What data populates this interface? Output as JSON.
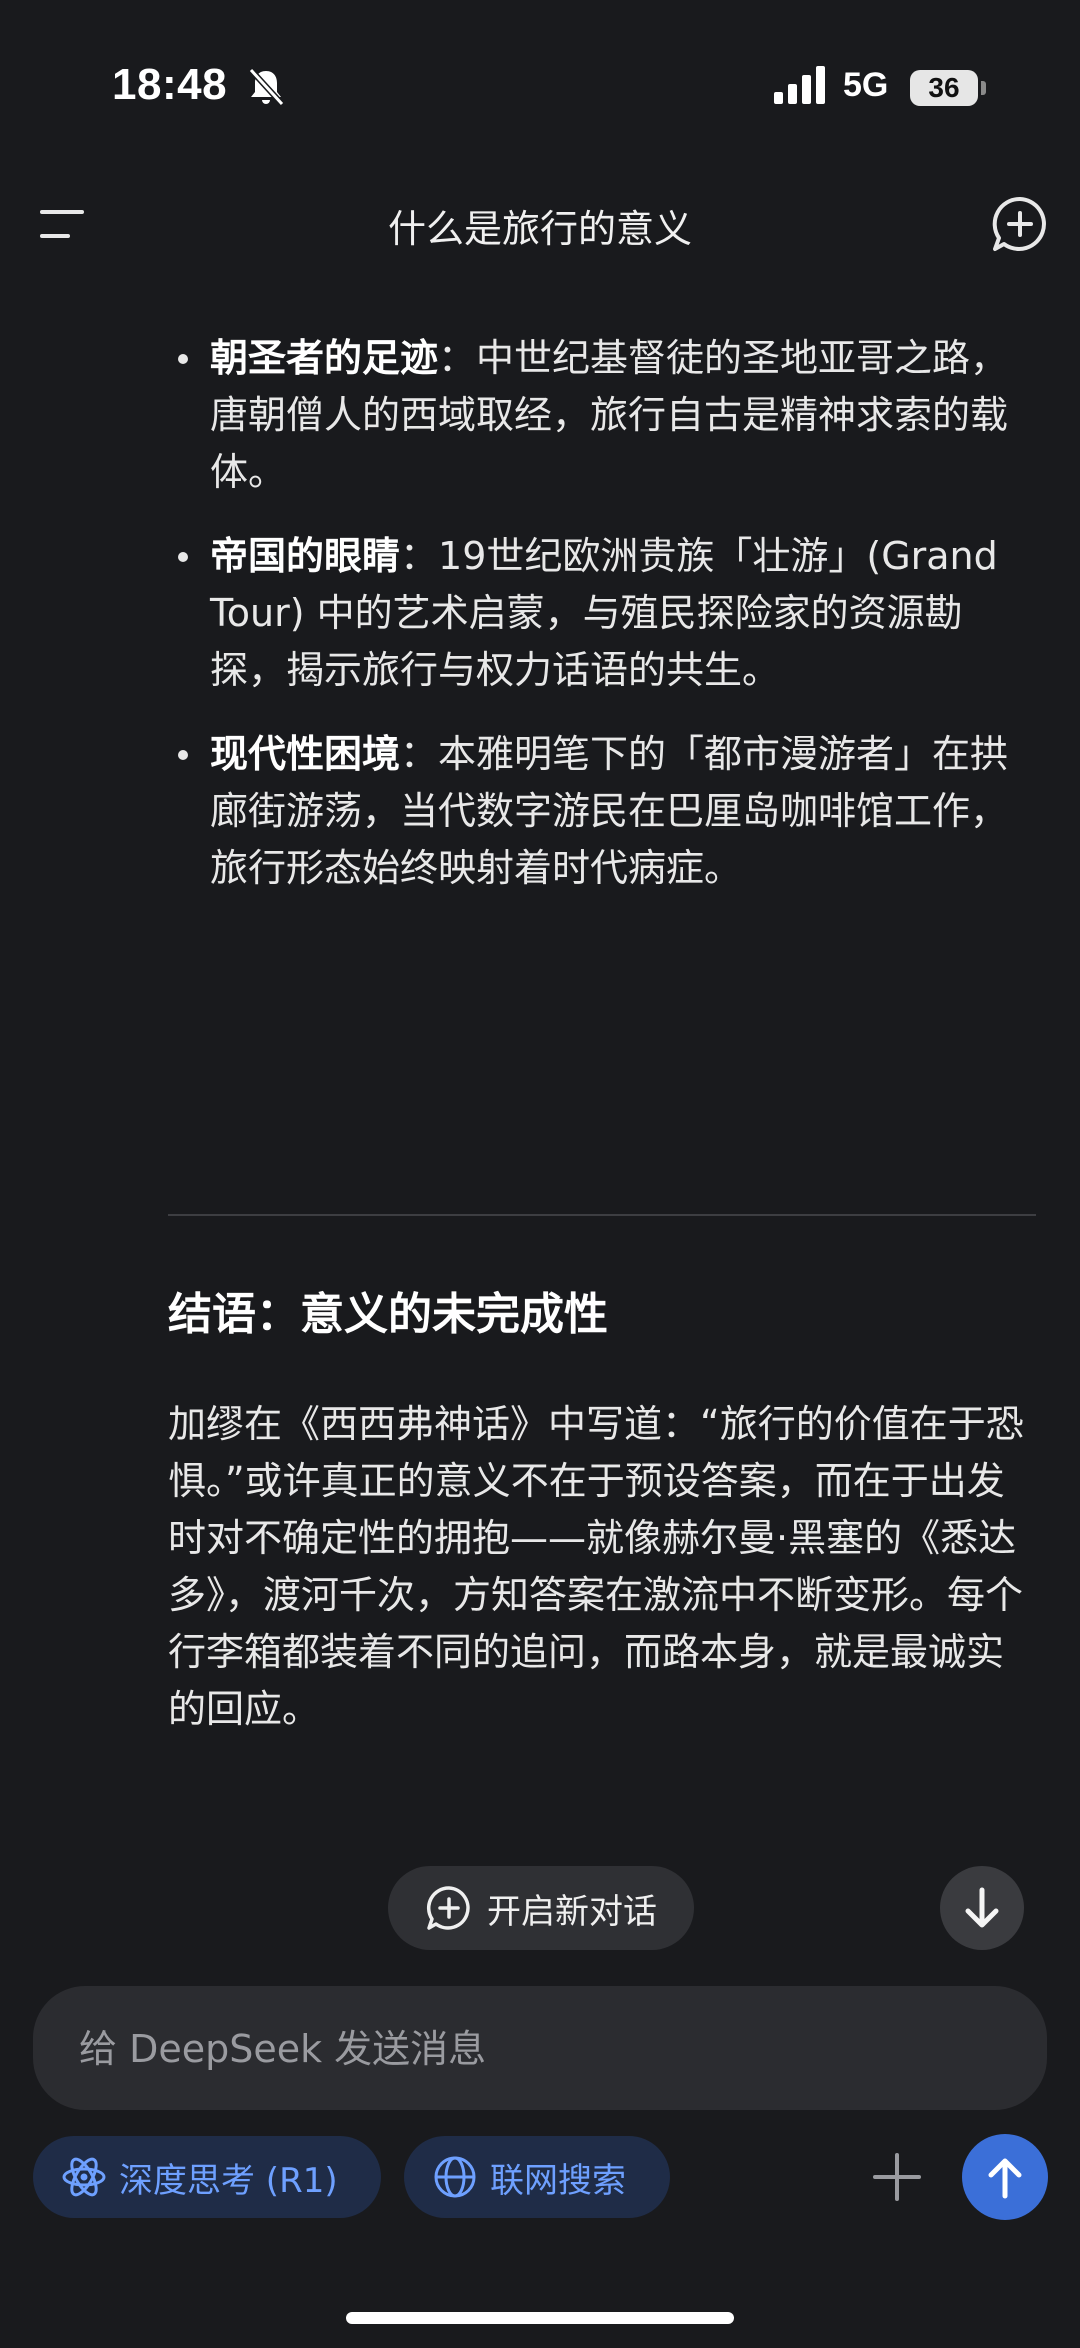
{
  "status_bar": {
    "time": "18:48",
    "network": "5G",
    "battery": "36"
  },
  "header": {
    "title": "什么是旅行的意义"
  },
  "content": {
    "bullets": [
      {
        "term": "朝圣者的足迹",
        "text": "：中世纪基督徒的圣地亚哥之路，唐朝僧人的西域取经，旅行自古是精神求索的载体。"
      },
      {
        "term": "帝国的眼睛",
        "text": "：19世纪欧洲贵族「壮游」(Grand Tour) 中的艺术启蒙，与殖民探险家的资源勘探，揭示旅行与权力话语的共生。"
      },
      {
        "term": "现代性困境",
        "text": "：本雅明笔下的「都市漫游者」在拱廊街游荡，当代数字游民在巴厘岛咖啡馆工作，旅行形态始终映射着时代病症。"
      }
    ],
    "section_heading": "结语：意义的未完成性",
    "paragraph": "加缪在《西西弗神话》中写道：“旅行的价值在于恐惧。”或许真正的意义不在于预设答案，而在于出发时对不确定性的拥抱——就像赫尔曼·黑塞的《悉达多》，渡河千次，方知答案在激流中不断变形。每个行李箱都装着不同的追问，而路本身，就是最诚实的回应。"
  },
  "actions": {
    "new_dialog_label": "开启新对话"
  },
  "composer": {
    "placeholder": "给 DeepSeek 发送消息",
    "deep_think_label": "深度思考 (R1)",
    "web_search_label": "联网搜索"
  },
  "colors": {
    "background": "#191a1d",
    "accent": "#3b6fd8",
    "chip_text": "#6ea0ff",
    "chip_bg": "#1f2c47"
  },
  "icons": {
    "status": [
      "bell-off-icon",
      "signal-icon",
      "battery-icon"
    ],
    "header": [
      "menu-icon",
      "new-chat-icon"
    ],
    "floating": [
      "chat-plus-icon",
      "arrow-down-icon"
    ],
    "composer": [
      "atom-icon",
      "globe-icon",
      "plus-icon",
      "arrow-up-icon"
    ]
  }
}
